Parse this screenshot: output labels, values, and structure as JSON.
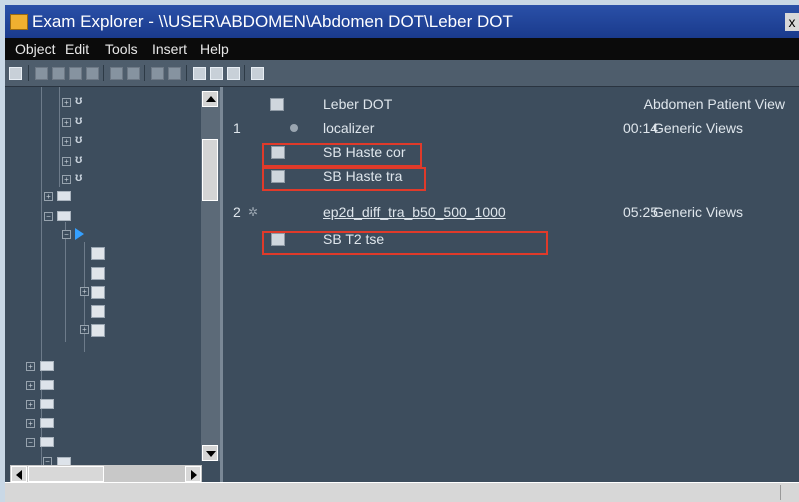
{
  "window": {
    "title": "Exam Explorer - \\\\USER\\ABDOMEN\\Abdomen DOT\\Leber DOT",
    "close_label": "x"
  },
  "menu": [
    {
      "label": "Object"
    },
    {
      "label": "Edit"
    },
    {
      "label": "Tools"
    },
    {
      "label": "Insert"
    },
    {
      "label": "Help"
    }
  ],
  "list": {
    "header": {
      "name": "Leber DOT",
      "view": "Abdomen Patient View"
    },
    "rows": [
      {
        "num": "1",
        "name": "localizer",
        "time": "00:14",
        "view": "Generic Views"
      },
      {
        "num": "",
        "name": "SB Haste cor",
        "time": "",
        "view": ""
      },
      {
        "num": "",
        "name": "SB Haste tra",
        "time": "",
        "view": ""
      },
      {
        "num": "2",
        "name": "ep2d_diff_tra_b50_500_1000",
        "time": "05:25",
        "view": "Generic Views"
      },
      {
        "num": "",
        "name": "SB T2 tse",
        "time": "",
        "view": ""
      }
    ]
  },
  "colors": {
    "highlight_box": "#e03a2a",
    "tree_arrow": "#35a0ff",
    "panel_bg": "#3d4d5d"
  }
}
